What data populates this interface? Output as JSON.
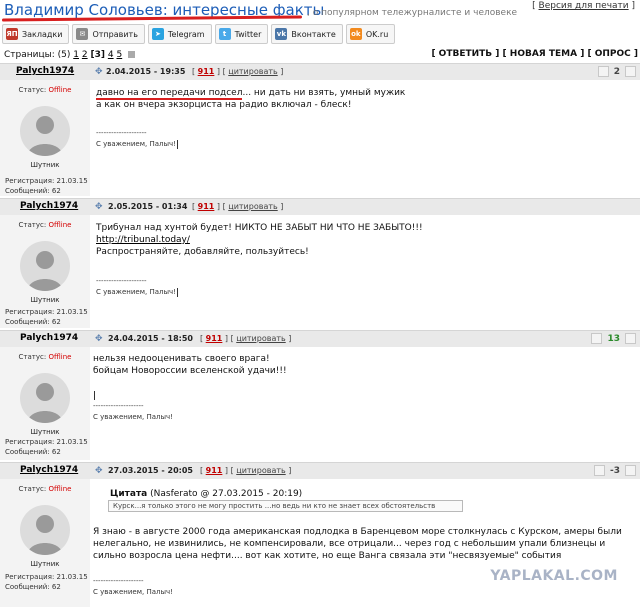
{
  "topic": {
    "title": "Владимир Соловьев: интересные факты",
    "subtitle": ", о популярном тележурналисте и человеке",
    "print_link": "Версия для печати"
  },
  "share": [
    {
      "label": "Закладки",
      "icon": "bookmark-icon",
      "glyph": "ЯП",
      "color": "#c0392b"
    },
    {
      "label": "Отправить",
      "icon": "mail-icon",
      "glyph": "✉",
      "color": "#8a8a8a"
    },
    {
      "label": "Telegram",
      "icon": "telegram-icon",
      "glyph": "➤",
      "color": "#2aa3e0"
    },
    {
      "label": "Twitter",
      "icon": "twitter-icon",
      "glyph": "t",
      "color": "#49a9e9"
    },
    {
      "label": "Вконтакте",
      "icon": "vk-icon",
      "glyph": "vk",
      "color": "#4a76a8"
    },
    {
      "label": "OK.ru",
      "icon": "ok-icon",
      "glyph": "ok",
      "color": "#f28a1e"
    }
  ],
  "pagination": {
    "label": "Страницы:",
    "total": "(5)",
    "p1": "1",
    "p2": "2",
    "p3": "[3]",
    "p4": "4",
    "p5": "5"
  },
  "actions": {
    "reply": "[ ОТВЕТИТЬ ]",
    "new_topic": "[ НОВАЯ ТЕМА ]",
    "poll": "[ ОПРОС ]"
  },
  "common": {
    "status_label": "Статус:",
    "offline": "Offline",
    "rank": "Шутник",
    "quote_link": "цитировать",
    "sig_line": "--------------------",
    "sig_text": "С уважением, Палыч!",
    "anchor": "✥"
  },
  "posts": [
    {
      "author": "Palych1974",
      "date": "2.04.2015 - 19:35",
      "num": "911",
      "rating": "2",
      "reg": "Регистрация: 21.03.15",
      "msgs": "Сообщений: 62",
      "line1a": "давно на его передачи подсел",
      "line1b": "... ни дать ни взять, умный мужик",
      "line2": "а как он вчера экзорциста на радио включал - блеск!"
    },
    {
      "author": "Palych1974",
      "date": "2.05.2015 - 01:34",
      "num": "911",
      "reg": "Регистрация: 21.03.15",
      "msgs": "Сообщений: 62",
      "line1": "Трибунал над хунтой будет! НИКТО НЕ ЗАБЫТ НИ ЧТО НЕ ЗАБЫТО!!!",
      "link": "http://tribunal.today/",
      "line3": "Распространяйте, добавляйте, пользуйтесь!"
    },
    {
      "author": "Palych1974",
      "date": "24.04.2015 - 18:50",
      "num": "911",
      "rating": "13",
      "reg": "Регистрация: 21.03.15",
      "msgs": "Сообщений: 62",
      "line1": "нельзя недооценивать своего врага!",
      "line2": "бойцам Новороссии вселенской удачи!!!"
    },
    {
      "author": "Palych1974",
      "date": "27.03.2015 - 20:05",
      "num": "911",
      "rating": "-3",
      "reg": "Регистрация: 21.03.15",
      "msgs": "Сообщений: 62",
      "quote_label": "Цитата",
      "quote_meta": "(Nasferato @ 27.03.2015 - 20:19)",
      "quote_text": "Курск...я только этого не могу простить ...но ведь ни кто не знает всех обстоятельств",
      "body": "Я знаю - в августе 2000 года американская подлодка в Баренцевом море столкнулась с Курском, амеры были нелегально, не извинились, не компенсировали, все отрицали... через год с небольшим упали близнецы и сильно возросла цена нефти.... вот как хотите, но еще Ванга связала эти \"несвязуемые\" события"
    }
  ],
  "watermark": "YAPLAKAL.COM"
}
